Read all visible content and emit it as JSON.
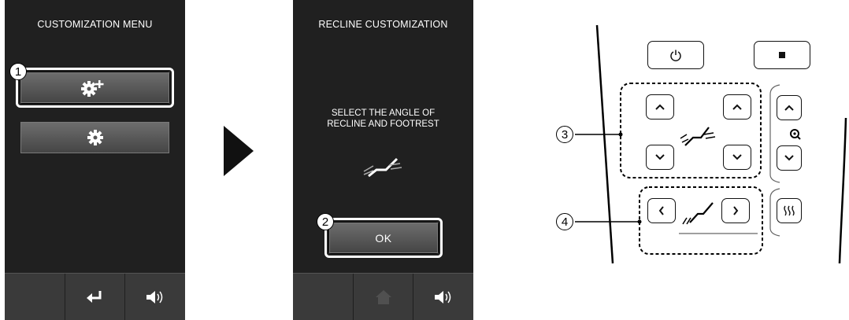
{
  "screen1": {
    "title": "CUSTOMIZATION MENU",
    "buttons": [
      {
        "icon": "gear-plus-icon"
      },
      {
        "icon": "gear-icon"
      }
    ],
    "bottom_bar": [
      {
        "icon": "blank"
      },
      {
        "icon": "return-icon"
      },
      {
        "icon": "volume-icon"
      }
    ],
    "step_marker": "1"
  },
  "arrow": {
    "icon": "right-triangle-arrow-icon"
  },
  "screen2": {
    "title": "RECLINE CUSTOMIZATION",
    "message_line1": "SELECT THE ANGLE OF",
    "message_line2": "RECLINE AND FOOTREST",
    "recline_icon": "recline-seat-icon",
    "ok_label": "OK",
    "step_marker": "2",
    "bottom_bar": [
      {
        "icon": "blank"
      },
      {
        "icon": "home-icon-disabled"
      },
      {
        "icon": "volume-icon"
      }
    ]
  },
  "remote": {
    "callouts": [
      "3",
      "4"
    ],
    "buttons": {
      "power": "power-icon",
      "stop": "stop-icon",
      "recline_up": "chevron-up-icon",
      "recline_down": "chevron-down-icon",
      "footrest_up": "chevron-up-icon",
      "footrest_down": "chevron-down-icon",
      "zoom_up": "chevron-up-icon",
      "zoom_down": "chevron-down-icon",
      "left": "chevron-left-icon",
      "right": "chevron-right-icon",
      "massage": "massage-icon"
    }
  }
}
